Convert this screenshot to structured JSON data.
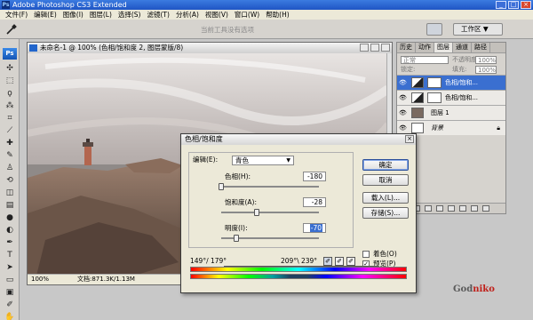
{
  "app": {
    "title": "Adobe Photoshop CS3 Extended",
    "logo": "Ps",
    "window_buttons": [
      "_",
      "□",
      "×"
    ]
  },
  "menu": [
    "文件(F)",
    "编辑(E)",
    "图像(I)",
    "图层(L)",
    "选择(S)",
    "滤镜(T)",
    "分析(A)",
    "视图(V)",
    "窗口(W)",
    "帮助(H)"
  ],
  "options_bar": {
    "hint": "当前工具没有选项",
    "workspace_label": "工作区 ▼",
    "tool_icon": "eyedropper-icon"
  },
  "tools": [
    "move-icon",
    "marquee-icon",
    "lasso-icon",
    "magic-wand-icon",
    "crop-icon",
    "slice-icon",
    "healing-brush-icon",
    "brush-icon",
    "stamp-icon",
    "history-brush-icon",
    "eraser-icon",
    "gradient-icon",
    "blur-icon",
    "dodge-icon",
    "pen-icon",
    "type-icon",
    "path-select-icon",
    "shape-icon",
    "notes-icon",
    "eyedropper-icon",
    "hand-icon",
    "zoom-icon"
  ],
  "document": {
    "title": "未命名-1 @ 100% (色相/饱和度 2, 图层蒙版/8)",
    "zoom": "100%",
    "info": "文档:871.3K/1.13M"
  },
  "layers_panel": {
    "tabs": [
      "历史",
      "动作",
      "图层",
      "通道",
      "路径"
    ],
    "active_tab": "图层",
    "blend_mode": "正常",
    "opacity_label": "不透明度:",
    "opacity": "100%",
    "lock_label": "锁定:",
    "fill_label": "填充:",
    "fill": "100%",
    "layers": [
      {
        "name": "色相/饱和...",
        "selected": true,
        "type": "adjustment"
      },
      {
        "name": "色相/饱和...",
        "selected": false,
        "type": "adjustment"
      },
      {
        "name": "图层 1",
        "selected": false,
        "type": "pixel"
      },
      {
        "name": "背景",
        "selected": false,
        "type": "background"
      }
    ],
    "bottom_icons": [
      "link-icon",
      "fx-icon",
      "mask-icon",
      "adjustment-icon",
      "folder-icon",
      "new-layer-icon",
      "trash-icon"
    ]
  },
  "dialog": {
    "title": "色相/饱和度",
    "edit_label": "编辑(E):",
    "edit_value": "青色",
    "hue_label": "色相(H):",
    "hue": "-180",
    "saturation_label": "饱和度(A):",
    "saturation": "-28",
    "lightness_label": "明度(I):",
    "lightness": "-70",
    "buttons": {
      "ok": "确定",
      "cancel": "取消",
      "load": "载入(L)...",
      "save": "存储(S)..."
    },
    "colorize_label": "着色(O)",
    "colorize_checked": false,
    "preview_label": "预览(P)",
    "preview_checked": true,
    "range_left": "149°/ 179°",
    "range_right": "209°\\ 239°",
    "slider_values": {
      "hue": -180,
      "saturation": -28,
      "lightness": -70
    }
  },
  "watermark": {
    "text_gray": "God",
    "text_red": "niko"
  },
  "colors": {
    "accent": "#3a6fd0",
    "titlebar": "#1f55c4"
  }
}
